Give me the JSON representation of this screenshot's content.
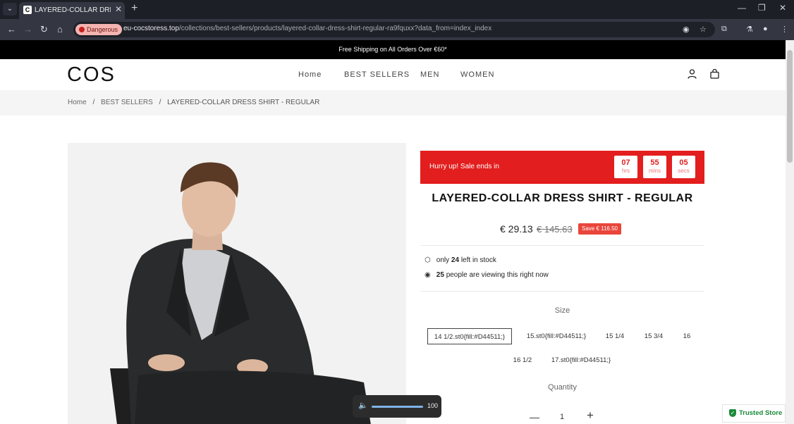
{
  "browser": {
    "tab_title": "LAYERED-COLLAR DRESS SHIRT - REGULAR",
    "security_label": "Dangerous",
    "url_host": "eu-cocstoress.top",
    "url_path": "/collections/best-sellers/products/layered-collar-dress-shirt-regular-ra9fquxx?data_from=index_index"
  },
  "site": {
    "announcement": "Free Shipping on All Orders Over €60*",
    "logo": "COS",
    "nav": [
      "Home",
      "BEST SELLERS",
      "MEN",
      "WOMEN"
    ],
    "breadcrumb": {
      "home": "Home",
      "category": "BEST SELLERS",
      "current": "LAYERED-COLLAR DRESS SHIRT - REGULAR",
      "sep": "/"
    }
  },
  "product": {
    "sale_text": "Hurry up!  Sale ends in",
    "timer": [
      {
        "value": "07",
        "unit": "hrs"
      },
      {
        "value": "55",
        "unit": "mins"
      },
      {
        "value": "05",
        "unit": "secs"
      }
    ],
    "title": "LAYERED-COLLAR DRESS SHIRT - REGULAR",
    "price": "€ 29.13",
    "old_price": "€ 145.63",
    "save": "Save € 116.50",
    "stock": {
      "prefix": "only",
      "count": "24",
      "suffix": "left in stock"
    },
    "viewers": {
      "count": "25",
      "suffix": "people are viewing this right now"
    },
    "size_label": "Size",
    "sizes": [
      "14 1/2.st0{fill:#D44511;}",
      "15.st0{fill:#D44511;}",
      "15 1/4",
      "15 3/4",
      "16",
      "16 1/2",
      "17.st0{fill:#D44511;}"
    ],
    "selected_size": "14 1/2.st0{fill:#D44511;}",
    "quantity_label": "Quantity",
    "quantity": "1"
  },
  "overlays": {
    "volume": "100",
    "trusted_store": "Trusted Store"
  }
}
